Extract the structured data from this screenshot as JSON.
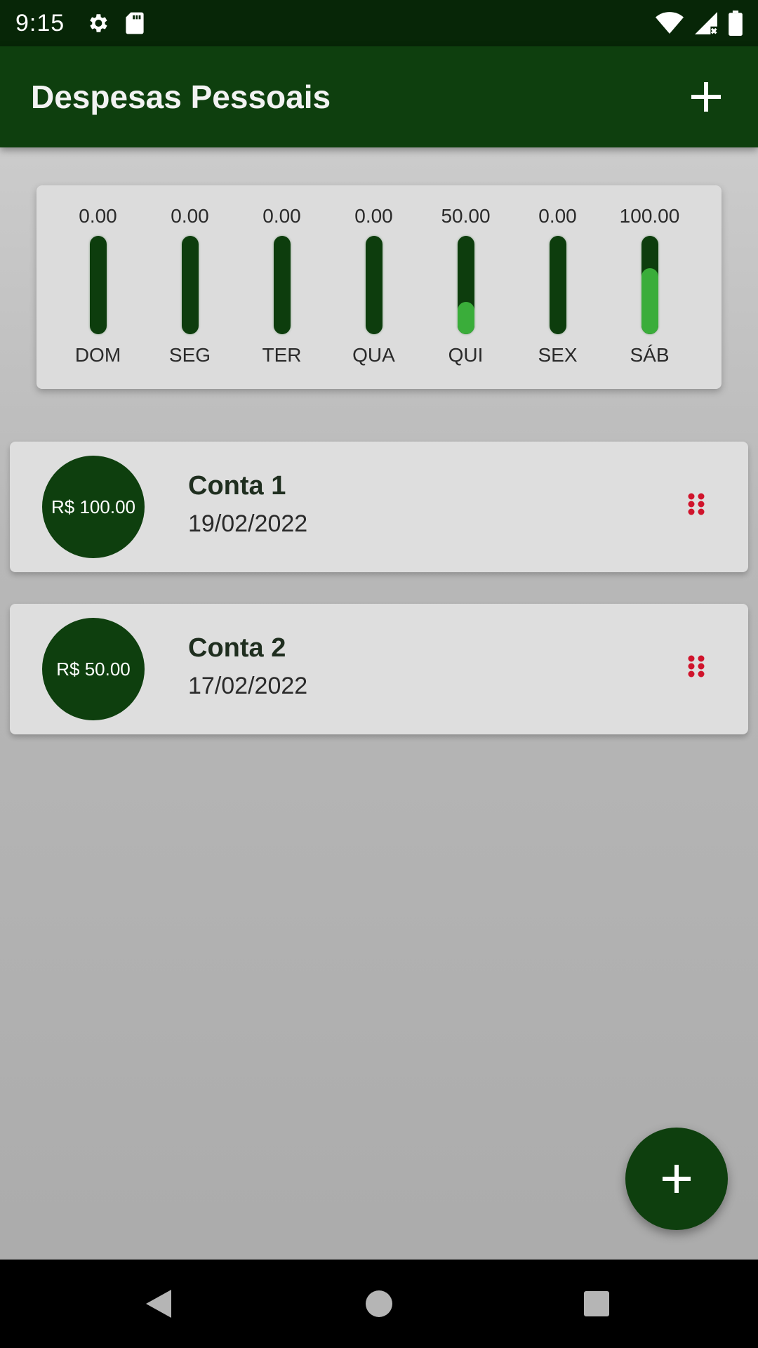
{
  "status_bar": {
    "time": "9:15",
    "icons": [
      "settings-icon",
      "sd-card-icon",
      "wifi-icon",
      "cellular-signal-icon",
      "battery-icon"
    ]
  },
  "app_bar": {
    "title": "Despesas Pessoais",
    "add_icon": "plus-icon"
  },
  "chart_data": {
    "type": "bar",
    "categories": [
      "DOM",
      "SEG",
      "TER",
      "QUA",
      "QUI",
      "SEX",
      "SÁB"
    ],
    "value_labels": [
      "0.00",
      "0.00",
      "0.00",
      "0.00",
      "50.00",
      "0.00",
      "100.00"
    ],
    "values": [
      0,
      0,
      0,
      0,
      50,
      0,
      100
    ],
    "fill_fraction": [
      0,
      0,
      0,
      0,
      0.33,
      0,
      0.67
    ],
    "colors": {
      "track": "#0d3d0d",
      "fill": "#3aad3a"
    }
  },
  "transactions": [
    {
      "amount": "R$ 100.00",
      "title": "Conta 1",
      "date": "19/02/2022",
      "delete_icon": "delete-icon"
    },
    {
      "amount": "R$ 50.00",
      "title": "Conta 2",
      "date": "17/02/2022",
      "delete_icon": "delete-icon"
    }
  ],
  "fab": {
    "icon": "plus-icon"
  },
  "nav_bar": {
    "icons": [
      "back-icon",
      "home-icon",
      "recents-icon"
    ]
  },
  "colors": {
    "primary": "#0e3f0e",
    "status_bar": "#072607",
    "accent_delete": "#d0142c"
  }
}
